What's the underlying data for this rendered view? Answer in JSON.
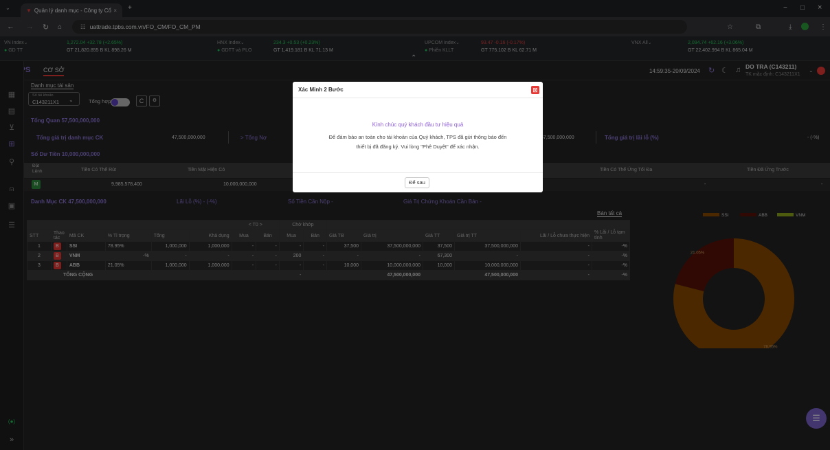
{
  "browser": {
    "tab_title": "Quản lý danh mục - Công ty Cổ",
    "tab_close": "×",
    "new_tab": "+",
    "url": "uattrade.tpbs.com.vn/FO_CM/FO_CM_PM",
    "window_controls": [
      "−",
      "□",
      "×"
    ]
  },
  "ticker": {
    "items": [
      {
        "name": "VN Index",
        "value": "1,272.04  +32.78  (+2.65%)",
        "sub": "GD TT",
        "gt": "GT 21,820.855 B   KL 898.26 M"
      },
      {
        "name": "HNX Index",
        "value": "234.3  +0.53  (+0.23%)",
        "sub": "GDTT và PLO",
        "gt": "GT 1,419.181 B   KL 71.13 M"
      },
      {
        "name": "UPCOM Index",
        "value": "93.47  -0.16  (-0.17%)",
        "sub": "Phiên KLLT",
        "gt": "GT 775.102 B   KL 62.71 M"
      },
      {
        "name": "VNX All",
        "value": "2,094.74  +62.16  (+3.06%)",
        "sub": "",
        "gt": "GT 22,402.994 B   KL 865.04 M"
      }
    ]
  },
  "header": {
    "logo": "TPS",
    "nav": "CƠ SỞ",
    "datetime": "14:59:35-20/09/2024",
    "user_name": "DO TRA (C143211)",
    "user_account": "TK mặc định: C143211X1"
  },
  "portfolio": {
    "breadcrumb": "Danh mục tài sản",
    "account_label": "Số tài khoản",
    "account_value": "C143211X1",
    "summary_toggle": "Tổng hợp",
    "overview": "Tổng Quan  57,500,000,000",
    "total_value_label": "Tổng giá trị danh mục CK",
    "total_value": "47,500,000,000",
    "total_debt": "> Tổng Nợ",
    "hidden_value": "57,500,000,000",
    "profit_label": "Tổng giá trị lãi lỗ (%)",
    "profit_value": "- (-%)",
    "cash_balance": "Số Dư Tiền  10,000,000,000",
    "cash_headers": [
      "Đặt Lệnh",
      "Tiền Có Thể Rút",
      "Tiền Mặt Hiện Có",
      "",
      "Tiền Có Thể Ứng Tối Đa",
      "Tiền Đã Ứng Trước"
    ],
    "cash_row": [
      "M",
      "9,985,578,400",
      "10,000,000,000",
      "-",
      "-",
      "-"
    ],
    "stock_list": "Danh Mục CK  47,500,000,000",
    "profit_pct": "Lãi Lỗ (%)  - (-%)",
    "cash_needed": "Số Tiền Cần Nộp  -",
    "stock_to_sell": "Giá Trị Chứng Khoán Cần Bán  -",
    "sell_all": "Bán tất cả"
  },
  "table": {
    "group_t0": "< T0 >",
    "group_pending": "Chờ khớp",
    "headers": [
      "STT",
      "Thao tác",
      "Mã CK",
      "% Tỉ trọng",
      "Tổng",
      "Khả dụng",
      "Mua",
      "Bán",
      "Mua",
      "Bán",
      "Giá TB",
      "Giá trị",
      "Giá TT",
      "Giá trị TT",
      "Lãi / Lỗ chưa thực hiện",
      "% Lãi / Lỗ tạm tính"
    ],
    "rows": [
      [
        "1",
        "B",
        "SSI",
        "78.95%",
        "1,000,000",
        "1,000,000",
        "-",
        "-",
        "-",
        "-",
        "37,500",
        "37,500,000,000",
        "37,500",
        "37,500,000,000",
        "-",
        "-%"
      ],
      [
        "2",
        "B",
        "VNM",
        "-%",
        "-",
        "-",
        "-",
        "-",
        "200",
        "-",
        "-",
        "-",
        "67,300",
        "-",
        "-",
        "-%"
      ],
      [
        "3",
        "B",
        "ABB",
        "21.05%",
        "1,000,000",
        "1,000,000",
        "-",
        "-",
        "-",
        "-",
        "10,000",
        "10,000,000,000",
        "10,000",
        "10,000,000,000",
        "-",
        "-%"
      ]
    ],
    "total_label": "TỔNG CỘNG",
    "total_value": "47,500,000,000",
    "total_value_tt": "47,500,000,000",
    "total_pl": "-",
    "total_pct": "-%"
  },
  "chart_data": {
    "type": "pie",
    "categories": [
      "SSI",
      "ABB",
      "VNM"
    ],
    "values": [
      78.95,
      21.05,
      0
    ],
    "data_labels": [
      "78.95%",
      "21.05%",
      ""
    ],
    "colors": [
      "#8a4a00",
      "#5a1208",
      "#8aa61a"
    ],
    "legend": "top"
  },
  "modal": {
    "title": "Xác Minh 2 Bước",
    "greeting": "Kính chúc quý khách đầu tư hiệu quả",
    "message_line1": "Để đảm bảo an toàn cho tài khoản của Quý khách, TPS đã gửi thông báo đến",
    "message_line2": "thiết bị đã đăng ký. Vui lòng \"Phê Duyệt\" để xác nhận.",
    "later_button": "Để sau"
  },
  "colors": {
    "accent": "#8c74d6",
    "brand": "#e53935",
    "up": "#24c45a",
    "down": "#e33d3d"
  }
}
